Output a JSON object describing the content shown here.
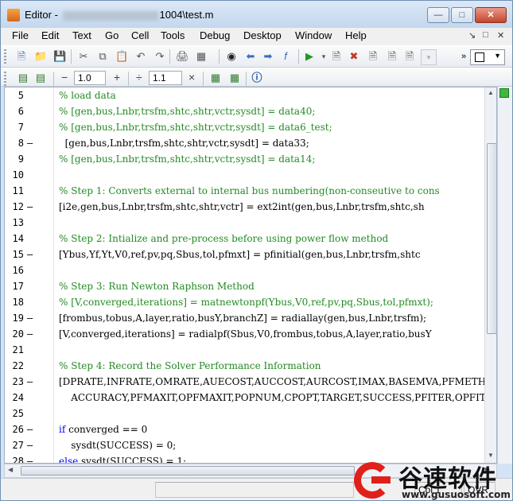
{
  "window": {
    "title_prefix": "Editor - ",
    "title_suffix": "1004\\test.m"
  },
  "menubar": {
    "items": [
      "File",
      "Edit",
      "Text",
      "Go",
      "Cell",
      "Tools",
      "Debug",
      "Desktop",
      "Window",
      "Help"
    ]
  },
  "toolbar2": {
    "minus_label": "−",
    "value1": "1.0",
    "plus_label": "+",
    "divide_label": "÷",
    "value2": "1.1",
    "times_label": "×"
  },
  "code_lines": [
    {
      "num": "5",
      "dash": "",
      "text": "% load data",
      "type": "comment"
    },
    {
      "num": "6",
      "dash": "",
      "text": "% [gen,bus,Lnbr,trsfm,shtc,shtr,vctr,sysdt] = data40;",
      "type": "comment"
    },
    {
      "num": "7",
      "dash": "",
      "text": "% [gen,bus,Lnbr,trsfm,shtc,shtr,vctr,sysdt] = data6_test;",
      "type": "comment"
    },
    {
      "num": "8",
      "dash": "–",
      "text": "  [gen,bus,Lnbr,trsfm,shtc,shtr,vctr,sysdt] = data33;",
      "type": "code"
    },
    {
      "num": "9",
      "dash": "",
      "text": "% [gen,bus,Lnbr,trsfm,shtc,shtr,vctr,sysdt] = data14;",
      "type": "comment"
    },
    {
      "num": "10",
      "dash": "",
      "text": "",
      "type": "code"
    },
    {
      "num": "11",
      "dash": "",
      "text": "% Step 1: Converts external to internal bus numbering(non-conseutive to cons",
      "type": "comment"
    },
    {
      "num": "12",
      "dash": "–",
      "text": "[i2e,gen,bus,Lnbr,trsfm,shtc,shtr,vctr] = ext2int(gen,bus,Lnbr,trsfm,shtc,sh",
      "type": "code"
    },
    {
      "num": "13",
      "dash": "",
      "text": "",
      "type": "code"
    },
    {
      "num": "14",
      "dash": "",
      "text": "% Step 2: Intialize and pre-process before using power flow method",
      "type": "comment"
    },
    {
      "num": "15",
      "dash": "–",
      "text": "[Ybus,Yf,Yt,V0,ref,pv,pq,Sbus,tol,pfmxt] = pfinitial(gen,bus,Lnbr,trsfm,shtc",
      "type": "code"
    },
    {
      "num": "16",
      "dash": "",
      "text": "",
      "type": "code"
    },
    {
      "num": "17",
      "dash": "",
      "text": "% Step 3: Run Newton Raphson Method",
      "type": "comment"
    },
    {
      "num": "18",
      "dash": "",
      "text": "% [V,converged,iterations] = matnewtonpf(Ybus,V0,ref,pv,pq,Sbus,tol,pfmxt);",
      "type": "comment"
    },
    {
      "num": "19",
      "dash": "–",
      "text": "[frombus,tobus,A,layer,ratio,busY,branchZ] = radiallay(gen,bus,Lnbr,trsfm);",
      "type": "code"
    },
    {
      "num": "20",
      "dash": "–",
      "text": "[V,converged,iterations] = radialpf(Sbus,V0,frombus,tobus,A,layer,ratio,busY",
      "type": "code"
    },
    {
      "num": "21",
      "dash": "",
      "text": "",
      "type": "code"
    },
    {
      "num": "22",
      "dash": "",
      "text": "% Step 4: Record the Solver Performance Information",
      "type": "comment"
    },
    {
      "num": "23",
      "dash": "–",
      "text": "[DPRATE,INFRATE,OMRATE,AUECOST,AUCCOST,AURCOST,IMAX,BASEMVA,PFMETHOD,OPTMODE",
      "type": "code"
    },
    {
      "num": "24",
      "dash": "",
      "text": "    ACCURACY,PFMAXIT,OPFMAXIT,POPNUM,CPOPT,TARGET,SUCCESS,PFITER,OPFITER] =",
      "type": "code"
    },
    {
      "num": "25",
      "dash": "",
      "text": "",
      "type": "code"
    },
    {
      "num": "26",
      "dash": "–",
      "text": "converged == 0",
      "type": "if"
    },
    {
      "num": "27",
      "dash": "–",
      "text": "    sysdt(SUCCESS) = 0;",
      "type": "code"
    },
    {
      "num": "28",
      "dash": "–",
      "text": " sysdt(SUCCESS) = 1;",
      "type": "else"
    }
  ],
  "keywords": {
    "if": "if ",
    "else": "else"
  },
  "statusbar": {
    "cell1": "",
    "col_label": "Col  1",
    "ovr_label": "OVR"
  },
  "watermark": {
    "title": "谷速软件",
    "url": "www.gusuosoft.com"
  },
  "colors": {
    "comment": "#228b22",
    "keyword": "#0000ff",
    "watermark_red": "#e0201b"
  }
}
